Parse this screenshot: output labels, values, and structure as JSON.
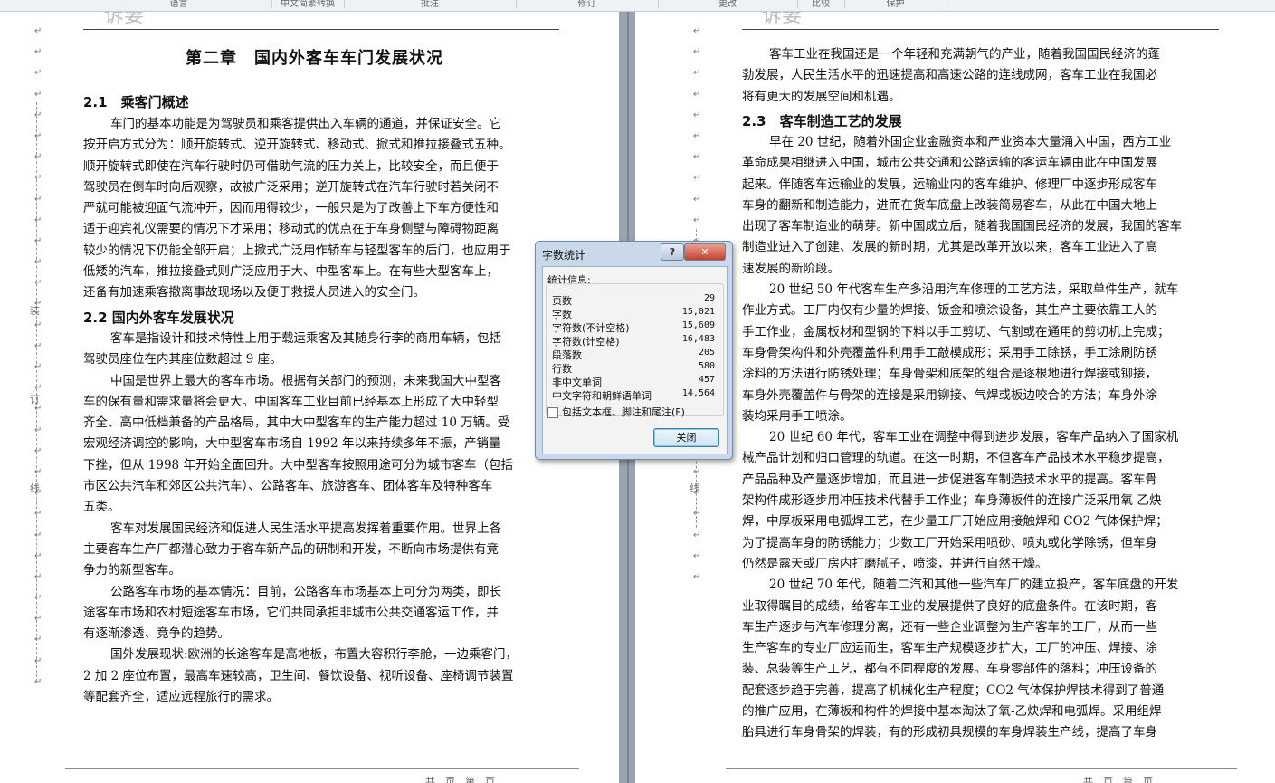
{
  "ribbon": {
    "groups": [
      "语言",
      "中文简繁转换",
      "批注",
      "修订",
      "更改",
      "比较",
      "保护"
    ]
  },
  "left_page": {
    "chapter_title": "第二章　国内外客车车门发展状况",
    "section_1_heading": "2.1　乘客门概述",
    "section_1_lines": [
      "车门的基本功能是为驾驶员和乘客提供出入车辆的通道，并保证安全。它",
      "按开启方式分为：顺开旋转式、逆开旋转式、移动式、掀式和推拉接叠式五种。",
      "顺开旋转式即使在汽车行驶时仍可借助气流的压力关上，比较安全，而且便于",
      "驾驶员在倒车时向后观察，故被广泛采用；逆开旋转式在汽车行驶时若关闭不",
      "严就可能被迎面气流冲开，因而用得较少，一般只是为了改善上下车方便性和",
      "适于迎宾礼仪需要的情况下才采用；移动式的优点在于车身侧壁与障碍物距离",
      "较少的情况下仍能全部开启；上掀式广泛用作轿车与轻型客车的后门，也应用于",
      "低矮的汽车，推拉接叠式则广泛应用于大、中型客车上。在有些大型客车上，",
      "还备有加速乘客撤离事故现场以及便于救援人员进入的安全门。"
    ],
    "section_2_heading": "2.2 国内外客车发展状况",
    "section_2_lines": [
      "客车是指设计和技术特性上用于载运乘客及其随身行李的商用车辆，包括",
      "驾驶员座位在内其座位数超过 9 座。",
      "中国是世界上最大的客车市场。根据有关部门的预测，未来我国大中型客",
      "车的保有量和需求量将会更大。中国客车工业目前已经基本上形成了大中轻型",
      "齐全、高中低档兼备的产品格局，其中大中型客车的生产能力超过 10 万辆。受",
      "宏观经济调控的影响，大中型客车市场自 1992 年以来持续多年不振，产销量",
      "下挫，但从 1998 年开始全面回升。大中型客车按照用途可分为城市客车（包括",
      "市区公共汽车和郊区公共汽车）、公路客车、旅游客车、团体客车及特种客车",
      "五类。",
      "客车对发展国民经济和促进人民生活水平提高发挥着重要作用。世界上各",
      "主要客车生产厂都潜心致力于客车新产品的研制和开发，不断向市场提供有竞",
      "争力的新型客车。",
      "公路客车市场的基本情况：目前，公路客车市场基本上可分为两类，即长",
      "途客车市场和农村短途客车市场，它们共同承担非城市公共交通客运工作，并",
      "有逐渐渗透、竞争的趋势。",
      "国外发展现状:欧洲的长途客车是高地板，布置大容积行李舱，一边乘客门，",
      "2 加 2 座位布置，最高车速较高，卫生间、餐饮设备、视听设备、座椅调节装置",
      "等配套齐全，适应远程旅行的需求。"
    ],
    "binding_marks": [
      "装",
      "订",
      "线"
    ],
    "footer": "共　页　第　页"
  },
  "right_page": {
    "intro_lines": [
      "客车工业在我国还是一个年轻和充满朝气的产业，随着我国国民经济的蓬",
      "勃发展，人民生活水平的迅速提高和高速公路的连线成网，客车工业在我国必",
      "将有更大的发展空间和机遇。"
    ],
    "section_3_heading": "2.3　客车制造工艺的发展",
    "section_3_lines": [
      "早在 20 世纪，随着外国企业金融资本和产业资本大量涌入中国，西方工业",
      "革命成果相继进入中国，城市公共交通和公路运输的客运车辆由此在中国发展",
      "起来。伴随客车运输业的发展，运输业内的客车维护、修理厂中逐步形成客车",
      "车身的翻新和制造能力，进而在货车底盘上改装简易客车，从此在中国大地上",
      "出现了客车制造业的萌芽。新中国成立后，随着我国国民经济的发展，我国的客车",
      "制造业进入了创建、发展的新时期，尤其是改革开放以来，客车工业进入了高",
      "速发展的新阶段。",
      "20 世纪 50 年代客车生产多沿用汽车修理的工艺方法，采取单件生产，就车",
      "作业方式。工厂内仅有少量的焊接、钣金和喷涂设备，其生产主要依靠工人的",
      "手工作业，金属板材和型钢的下料以手工剪切、气割或在通用的剪切机上完成；",
      "车身骨架构件和外壳覆盖件利用手工敲模成形；采用手工除锈，手工涂刷防锈",
      "涂料的方法进行防锈处理；车身骨架和底架的组合是逐根地进行焊接或铆接，",
      "车身外壳覆盖件与骨架的连接是采用铆接、气焊或板边咬合的方法；车身外涂",
      "装均采用手工喷涂。",
      "20 世纪 60 年代，客车工业在调整中得到进步发展，客车产品纳入了国家机",
      "械产品计划和归口管理的轨道。在这一时期，不但客车产品技术水平稳步提高，",
      "产品品种及产量逐步增加，而且进一步促进客车制造技术水平的提高。客车骨",
      "架构件成形逐步用冲压技术代替手工作业；车身薄板件的连接广泛采用氧-乙炔",
      "焊，中厚板采用电弧焊工艺，在少量工厂开始应用接触焊和 CO2 气体保护焊；",
      "为了提高车身的防锈能力；少数工厂开始采用喷砂、喷丸或化学除锈，但车身",
      "仍然是露天或厂房内打磨腻子，喷漆，并进行自然干燥。",
      "20 世纪 70 年代，随着二汽和其他一些汽车厂的建立投产，客车底盘的开发",
      "业取得瞩目的成绩，给客车工业的发展提供了良好的底盘条件。在该时期，客",
      "车生产逐步与汽车修理分离，还有一些企业调整为生产客车的工厂，从而一些",
      "生产客车的专业厂应运而生，客车生产规模逐步扩大，工厂的冲压、焊接、涂",
      "装、总装等生产工艺，都有不同程度的发展。车身零部件的落料；冲压设备的",
      "配套逐步趋于完善，提高了机械化生产程度；CO2 气体保护焊技术得到了普通",
      "的推广应用，在薄板和构件的焊接中基本淘汰了氧-乙炔焊和电弧焊。采用组焊",
      "胎具进行车身骨架的焊装，有的形成初具规模的车身焊装生产线，提高了车身"
    ],
    "footer": "共　页　第　页"
  },
  "dialog": {
    "title": "字数统计",
    "help_label": "?",
    "close_x_label": "✕",
    "stats_label": "统计信息:",
    "stats": [
      {
        "name": "页数",
        "value": "29"
      },
      {
        "name": "字数",
        "value": "15,021"
      },
      {
        "name": "字符数(不计空格)",
        "value": "15,609"
      },
      {
        "name": "字符数(计空格)",
        "value": "16,483"
      },
      {
        "name": "段落数",
        "value": "205"
      },
      {
        "name": "行数",
        "value": "580"
      },
      {
        "name": "非中文单词",
        "value": "457"
      },
      {
        "name": "中文字符和朝鲜语单词",
        "value": "14,564"
      }
    ],
    "checkbox_label": "包括文本框、脚注和尾注(F)",
    "close_button": "关闭"
  }
}
